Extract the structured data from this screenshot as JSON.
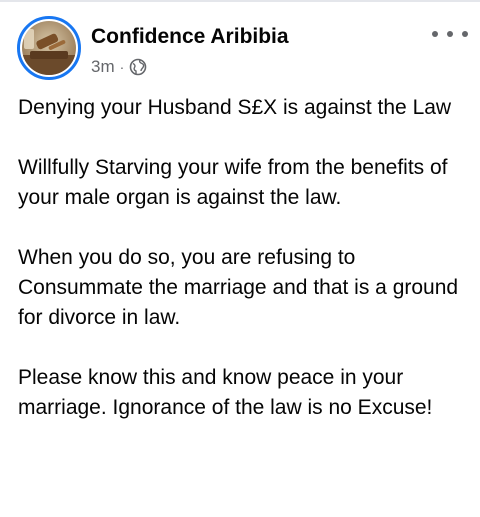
{
  "post": {
    "author_name": "Confidence Aribibia",
    "timestamp": "3m",
    "separator": "·",
    "privacy_icon": "globe-icon",
    "more_icon": "more-horizontal-icon",
    "avatar_icon": "gavel-avatar",
    "paragraphs": [
      "Denying your Husband S£X is against the Law",
      "Willfully Starving your wife from the benefits of your male organ is against the law.",
      "When you do so, you are refusing to Consummate the marriage and that is a ground for divorce in law.",
      "Please know this and know peace in your marriage. Ignorance of the law is no Excuse!"
    ]
  },
  "colors": {
    "avatar_ring": "#1877f2",
    "text_primary": "#050505",
    "text_secondary": "#65676b",
    "divider": "#e4e6eb"
  }
}
